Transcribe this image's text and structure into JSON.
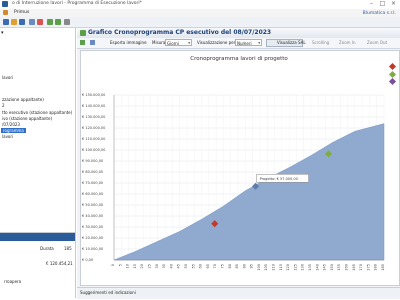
{
  "window": {
    "title": "o di Interruzione lavori - Programma di Esecuzione lavori*"
  },
  "menu": {
    "items": [
      "Primus"
    ]
  },
  "brand": "Blumatica s.r.l.",
  "left_panel": {
    "tree": [
      {
        "label": "lavori",
        "selected": false
      },
      {
        "label": "zzazione appaltante)",
        "selected": false
      },
      {
        "label": "2",
        "selected": false
      },
      {
        "label": "tto esecutivo (stazione appaltante)",
        "selected": false
      },
      {
        "label": "ivo (stazione appaltante)",
        "selected": false
      },
      {
        "label": "/07/2023",
        "selected": false
      },
      {
        "label": "rogramma",
        "selected": true
      },
      {
        "label": "lavori",
        "selected": false
      }
    ],
    "footer": {
      "col1": "",
      "col_durata": "Durata",
      "col_val": "185",
      "total": "€ 120.454,21",
      "bottom": "rroapera"
    }
  },
  "main": {
    "title": "Grafico Cronoprogramma CP esecutivo del 08/07/2023"
  },
  "chart_toolbar": {
    "esporta": "Esporta immagine",
    "misura_label": "Misura",
    "misura_value": "Giorni",
    "visualizzazione_label": "Visualizzazione per",
    "visualizzazione_value": "Numeri",
    "visualizza_sal": "Visualizza SAL",
    "scrolling": "Scrolling",
    "zoom_in": "Zoom In",
    "zoom_out": "Zoom Out"
  },
  "status_bar": {
    "text": "Suggerimenti ed indicazioni"
  },
  "colors": {
    "area": "#90a9cf",
    "accent": "#2a5c9a",
    "marker_red": "#c0392b",
    "marker_green": "#7fae3e",
    "marker_purple": "#7b4f9a"
  },
  "chart_data": {
    "type": "area",
    "title": "Cronoprogramma lavori di progetto",
    "xlabel": "",
    "ylabel": "",
    "ylim": [
      0,
      150000
    ],
    "yticks": [
      "€ 0,00",
      "€ 10.000,00",
      "€ 20.000,00",
      "€ 30.000,00",
      "€ 40.000,00",
      "€ 50.000,00",
      "€ 60.000,00",
      "€ 70.000,00",
      "€ 80.000,00",
      "€ 90.000,00",
      "€ 100.000,00",
      "€ 110.000,00",
      "€ 120.000,00",
      "€ 130.000,00",
      "€ 140.000,00",
      "€ 150.000,00"
    ],
    "ytick_values": [
      0,
      10000,
      20000,
      30000,
      40000,
      50000,
      60000,
      70000,
      80000,
      90000,
      100000,
      110000,
      120000,
      130000,
      140000,
      150000
    ],
    "xlim": [
      0,
      185
    ],
    "x": [
      0,
      15,
      30,
      45,
      60,
      75,
      90,
      105,
      120,
      135,
      150,
      165,
      185
    ],
    "y": [
      0,
      8000,
      17000,
      26000,
      37000,
      49000,
      63000,
      74000,
      84000,
      95000,
      107000,
      117000,
      124000
    ],
    "markers": [
      {
        "x": 69,
        "y": 33000,
        "color": "#c0392b"
      },
      {
        "x": 97,
        "y": 67000,
        "color": "#5f7faa"
      },
      {
        "x": 147,
        "y": 96500,
        "color": "#7fae3e"
      }
    ],
    "tooltip": "Progetto: € 57.000,00",
    "legend": [
      {
        "color": "#c0392b"
      },
      {
        "color": "#7fae3e"
      },
      {
        "color": "#7b4f9a"
      }
    ],
    "grid": true,
    "legend_position": "top-right"
  }
}
